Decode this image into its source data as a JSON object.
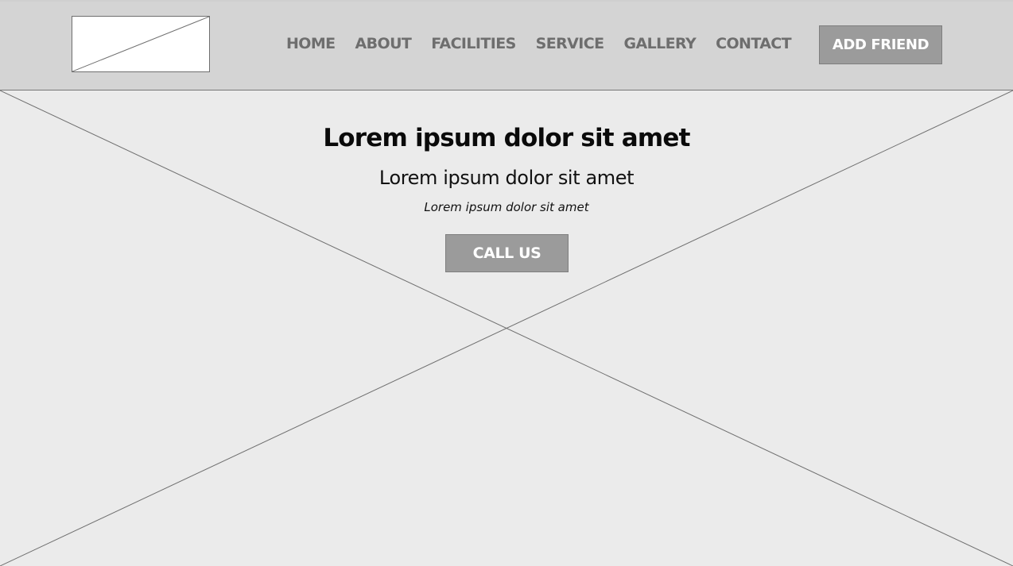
{
  "header": {
    "logo": "logo-image-placeholder",
    "nav": [
      "HOME",
      "ABOUT",
      "FACILITIES",
      "SERVICE",
      "GALLERY",
      "CONTACT"
    ],
    "cta_label": "ADD FRIEND"
  },
  "hero": {
    "background": "hero-image-placeholder",
    "title": "Lorem ipsum dolor sit amet",
    "subtitle": "Lorem ipsum dolor sit amet",
    "tagline": "Lorem ipsum dolor sit amet",
    "button_label": "CALL US"
  },
  "colors": {
    "header_bg": "#d4d4d4",
    "hero_bg": "#ebebeb",
    "nav_text": "#6e6e6e",
    "button_bg": "#9b9b9b",
    "button_text": "#ffffff"
  }
}
